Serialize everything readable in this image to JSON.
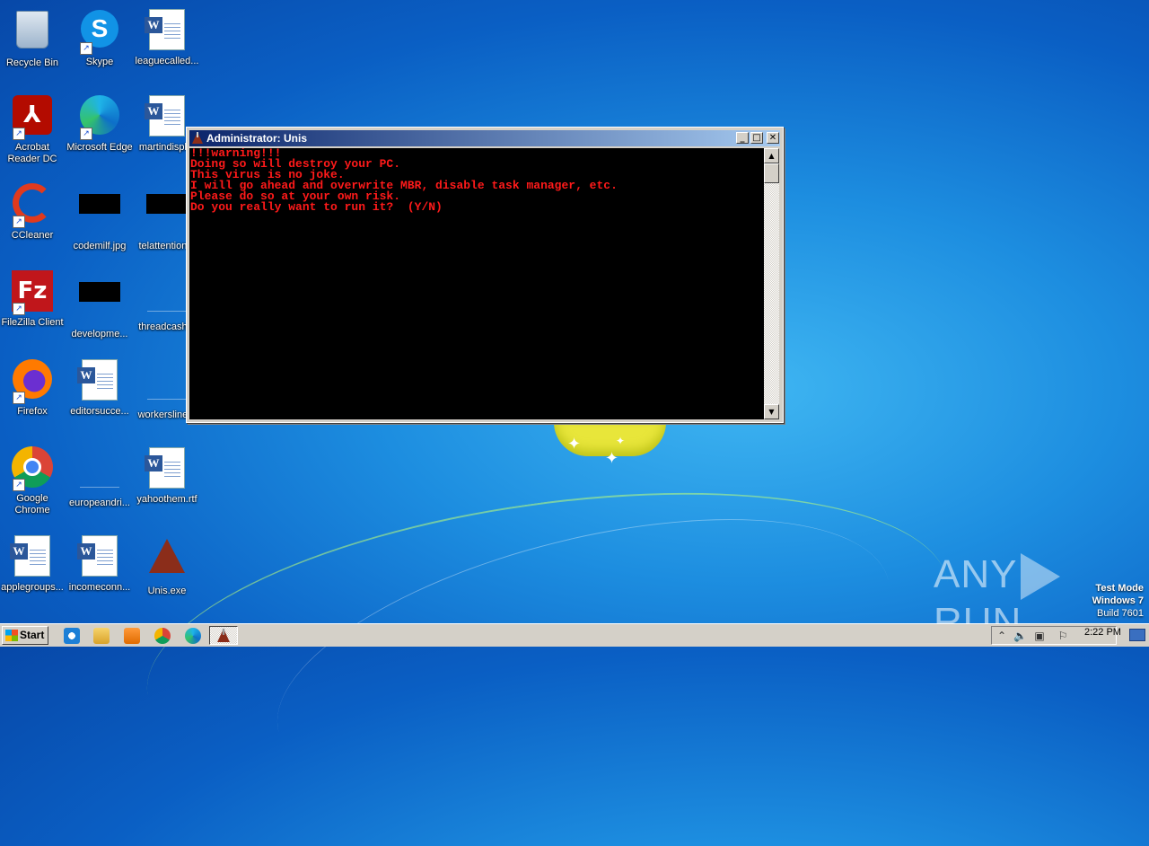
{
  "desktop": {
    "icons": [
      {
        "label": "Recycle Bin",
        "icon": "recycle-bin-icon"
      },
      {
        "label": "Skype",
        "icon": "skype-icon"
      },
      {
        "label": "leaguecalled...",
        "icon": "word-doc-icon"
      },
      {
        "label": "Acrobat Reader DC",
        "icon": "acrobat-icon"
      },
      {
        "label": "Microsoft Edge",
        "icon": "edge-icon"
      },
      {
        "label": "martindispl...",
        "icon": "word-doc-icon"
      },
      {
        "label": "CCleaner",
        "icon": "ccleaner-icon"
      },
      {
        "label": "codemilf.jpg",
        "icon": "image-file-icon"
      },
      {
        "label": "telattention...",
        "icon": "image-file-icon"
      },
      {
        "label": "FileZilla Client",
        "icon": "filezilla-icon"
      },
      {
        "label": "developme...",
        "icon": "image-file-icon"
      },
      {
        "label": "threadcash...",
        "icon": "blank-file-icon"
      },
      {
        "label": "Firefox",
        "icon": "firefox-icon"
      },
      {
        "label": "editorsucce...",
        "icon": "word-doc-icon"
      },
      {
        "label": "workersline...",
        "icon": "blank-file-icon"
      },
      {
        "label": "Google Chrome",
        "icon": "chrome-icon"
      },
      {
        "label": "europeandri...",
        "icon": "blank-file-icon"
      },
      {
        "label": "yahoothem.rtf",
        "icon": "word-doc-icon"
      },
      {
        "label": "applegroups...",
        "icon": "word-doc-icon"
      },
      {
        "label": "incomeconn...",
        "icon": "word-doc-icon"
      },
      {
        "label": "Unis.exe",
        "icon": "unis-exe-icon"
      }
    ]
  },
  "console_window": {
    "title": "Administrator: Unis",
    "lines": [
      "!!!warning!!!",
      "Doing so will destroy your PC.",
      "This virus is no joke.",
      "I will go ahead and overwrite MBR, disable task manager, etc.",
      "Please do so at your own risk.",
      "Do you really want to run it?  (Y/N)"
    ],
    "text_color": "#ff1a1a",
    "buttons": {
      "minimize": "_",
      "maximize": "□",
      "close": "✕"
    }
  },
  "watermark": {
    "brand_left": "ANY",
    "brand_right": "RUN"
  },
  "os_info": {
    "mode": "Test Mode",
    "os": "Windows 7",
    "build": "Build 7601"
  },
  "taskbar": {
    "start_label": "Start",
    "clock": "2:22 PM",
    "quick_launch": [
      "ie-icon",
      "explorer-icon",
      "media-player-icon",
      "chrome-icon",
      "edge-icon"
    ],
    "active_task_icon": "unis-task-icon"
  }
}
